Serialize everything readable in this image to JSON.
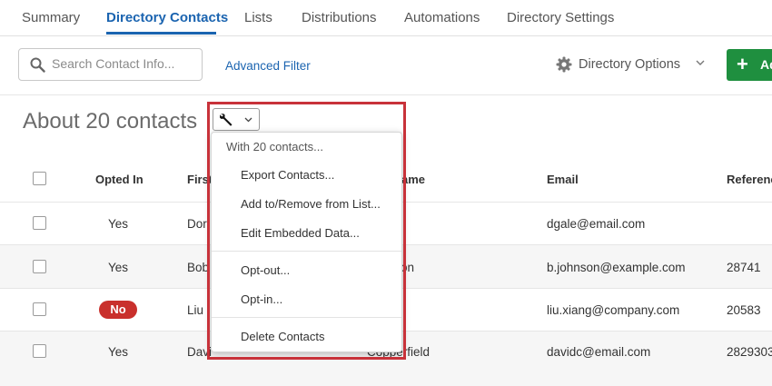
{
  "tabs": [
    {
      "label": "Summary",
      "active": false
    },
    {
      "label": "Directory Contacts",
      "active": true
    },
    {
      "label": "Lists",
      "active": false
    },
    {
      "label": "Distributions",
      "active": false
    },
    {
      "label": "Automations",
      "active": false
    },
    {
      "label": "Directory Settings",
      "active": false
    }
  ],
  "toolbar": {
    "search_placeholder": "Search Contact Info...",
    "advanced_filter": "Advanced Filter",
    "directory_options": "Directory Options",
    "add_label": "Ad"
  },
  "contacts": {
    "count_text": "About 20 contacts"
  },
  "table": {
    "headers": [
      "Opted In",
      "First",
      "ame",
      "Email",
      "Referenc"
    ],
    "rows": [
      {
        "opted_in": "Yes",
        "first": "Dor",
        "last": "",
        "email": "dgale@email.com",
        "reference": ""
      },
      {
        "opted_in": "Yes",
        "first": "Bob",
        "last": "on",
        "email": "b.johnson@example.com",
        "reference": "28741"
      },
      {
        "opted_in": "No",
        "first": "Liu",
        "last": "",
        "email": "liu.xiang@company.com",
        "reference": "20583"
      },
      {
        "opted_in": "Yes",
        "first": "Davi",
        "last": "Copperfield",
        "email": "davidc@email.com",
        "reference": "2829303"
      }
    ]
  },
  "menu": {
    "header": "With 20 contacts...",
    "items": [
      "Export Contacts...",
      "Add to/Remove from List...",
      "Edit Embedded Data...",
      "Opt-out...",
      "Opt-in...",
      "Delete Contacts"
    ]
  },
  "colors": {
    "accent": "#1b64b0",
    "add_button": "#1f8f3f",
    "badge_no": "#c9302c",
    "highlight": "#c8323a"
  }
}
